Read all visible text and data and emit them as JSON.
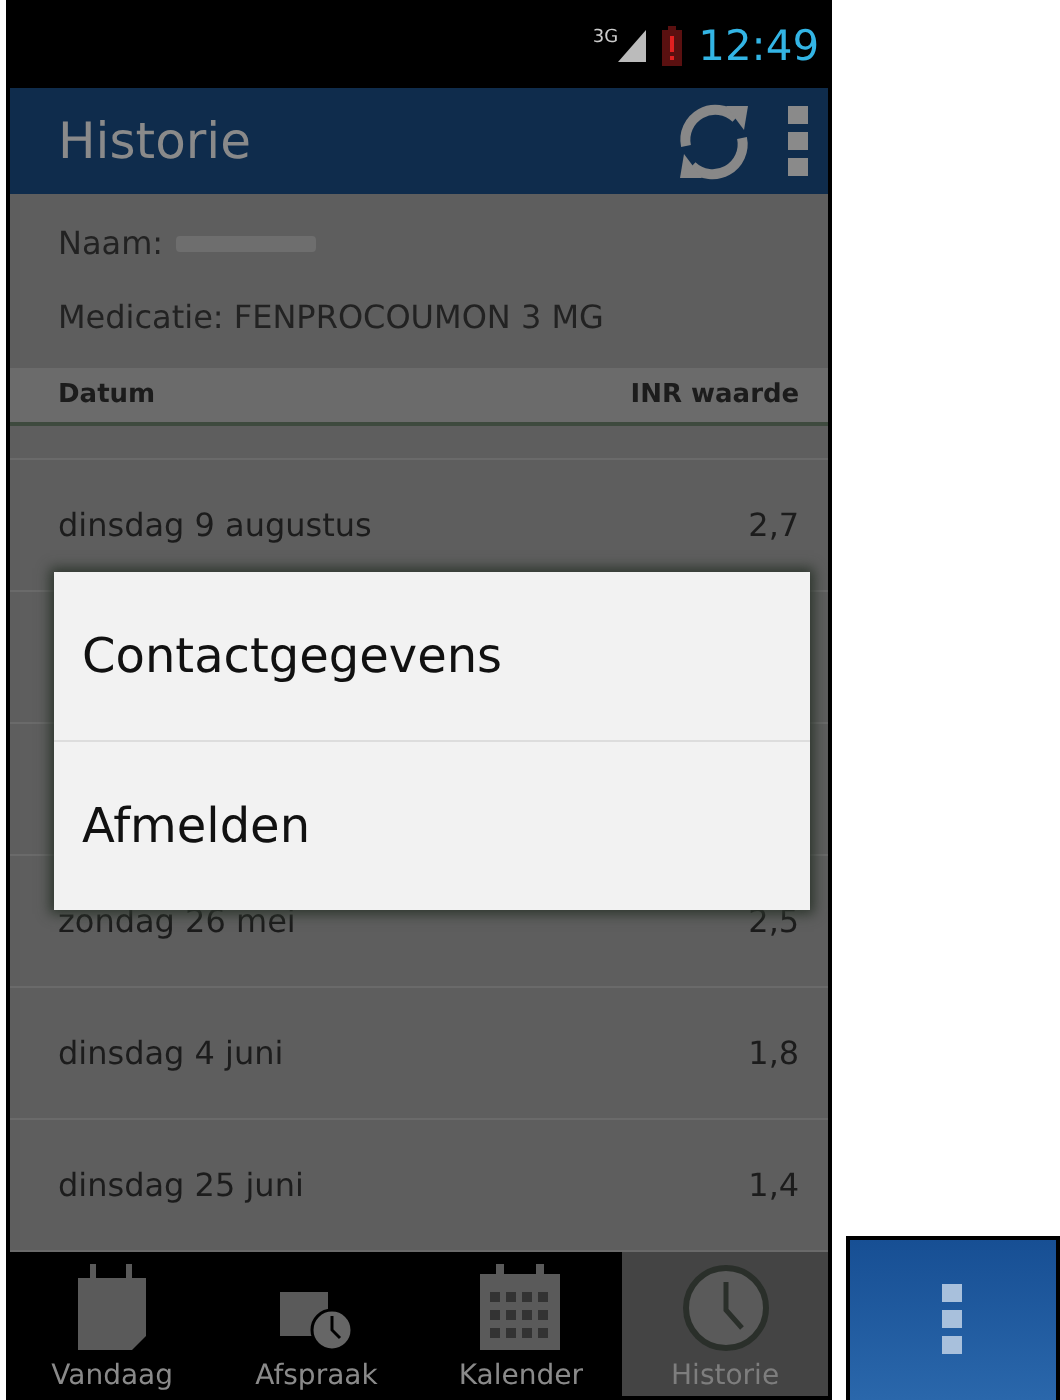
{
  "status_bar": {
    "network": "3G",
    "time": "12:49"
  },
  "action_bar": {
    "title": "Historie"
  },
  "info": {
    "name_label": "Naam:",
    "medication": "Medicatie: FENPROCOUMON 3 MG"
  },
  "table": {
    "columns": [
      "Datum",
      "INR waarde"
    ],
    "rows": [
      {
        "date": "dinsdag 9 augustus",
        "inr": "2,7"
      },
      {
        "date": "zondag 26 mei",
        "inr": "2,5"
      },
      {
        "date": "dinsdag 4 juni",
        "inr": "1,8"
      },
      {
        "date": "dinsdag 25 juni",
        "inr": "1,4"
      }
    ]
  },
  "overflow_menu": {
    "items": [
      "Contactgegevens",
      "Afmelden"
    ]
  },
  "bottom_nav": [
    {
      "label": "Vandaag",
      "kind": "page",
      "selected": false
    },
    {
      "label": "Afspraak",
      "kind": "appointment",
      "selected": false
    },
    {
      "label": "Kalender",
      "kind": "calendar",
      "selected": false
    },
    {
      "label": "Historie",
      "kind": "clock",
      "selected": true
    }
  ]
}
